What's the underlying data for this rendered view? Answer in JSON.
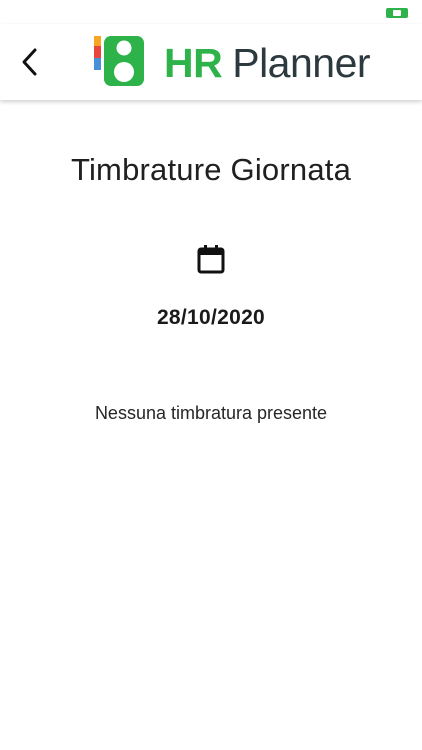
{
  "colors": {
    "brand_green": "#2eb34a",
    "logo_text_dark": "#2c3a3f",
    "status_indicator": "#2eb34a"
  },
  "header": {
    "back_icon": "chevron-left-icon",
    "logo": {
      "hr_text": "HR",
      "planner_text": "Planner"
    }
  },
  "main": {
    "title": "Timbrature Giornata",
    "calendar_icon": "calendar-icon",
    "date": "28/10/2020",
    "empty_message": "Nessuna timbratura presente"
  }
}
